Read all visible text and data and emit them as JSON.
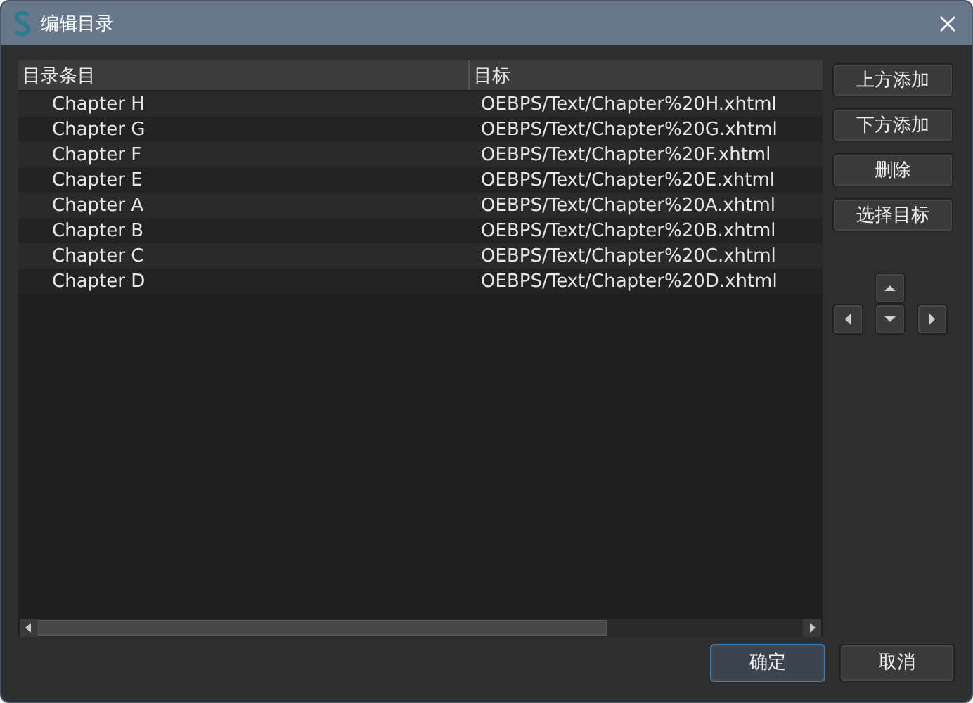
{
  "window": {
    "title": "编辑目录"
  },
  "table": {
    "columns": [
      "目录条目",
      "目标"
    ],
    "rows": [
      {
        "entry": "Chapter H",
        "target": "OEBPS/Text/Chapter%20H.xhtml"
      },
      {
        "entry": "Chapter G",
        "target": "OEBPS/Text/Chapter%20G.xhtml"
      },
      {
        "entry": "Chapter F",
        "target": "OEBPS/Text/Chapter%20F.xhtml"
      },
      {
        "entry": "Chapter E",
        "target": "OEBPS/Text/Chapter%20E.xhtml"
      },
      {
        "entry": "Chapter A",
        "target": "OEBPS/Text/Chapter%20A.xhtml"
      },
      {
        "entry": "Chapter B",
        "target": "OEBPS/Text/Chapter%20B.xhtml"
      },
      {
        "entry": "Chapter C",
        "target": "OEBPS/Text/Chapter%20C.xhtml"
      },
      {
        "entry": "Chapter D",
        "target": "OEBPS/Text/Chapter%20D.xhtml"
      }
    ]
  },
  "side_buttons": [
    "上方添加",
    "下方添加",
    "删除",
    "选择目标"
  ],
  "dialog_buttons": [
    {
      "label": "确定",
      "default": true
    },
    {
      "label": "取消",
      "default": false
    }
  ]
}
